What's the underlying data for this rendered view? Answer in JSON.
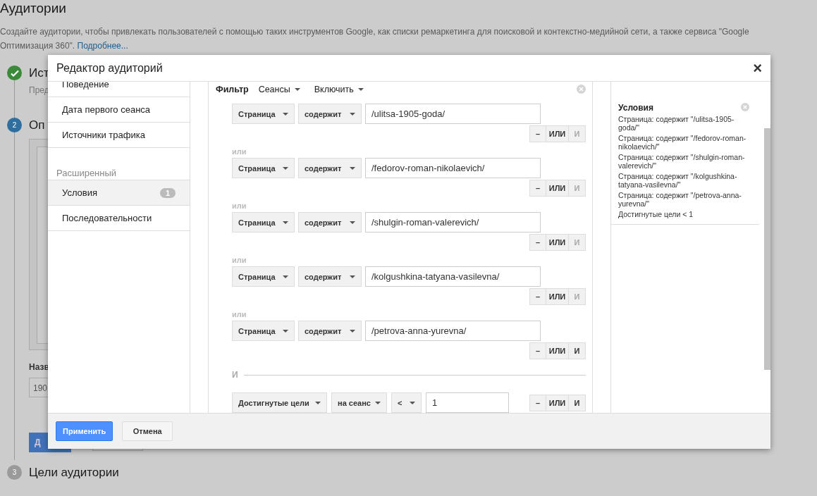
{
  "page": {
    "title": "Аудитории",
    "description": "Создайте аудитории, чтобы привлекать пользователей с помощью таких инструментов Google, как списки ремаркетинга для поисковой и контекстно-медийной сети, а также сервиса \"Google Оптимизация 360\".",
    "link": "Подробнее..."
  },
  "steps": [
    {
      "kind": "done",
      "title": "Ист",
      "subtitle": "Пред"
    },
    {
      "kind": "current",
      "number": "2",
      "title": "Оп",
      "field_label": "Назв",
      "field_value": "190",
      "button": "Д"
    },
    {
      "kind": "pending",
      "number": "3",
      "title": "Цели аудитории"
    }
  ],
  "modal": {
    "title": "Редактор аудиторий",
    "close": "×",
    "nav": [
      {
        "kind": "item",
        "label": "Поведение",
        "selected": false
      },
      {
        "kind": "item",
        "label": "Дата первого сеанса",
        "selected": false
      },
      {
        "kind": "item",
        "label": "Источники трафика",
        "selected": false
      },
      {
        "kind": "header",
        "label": "Расширенный"
      },
      {
        "kind": "item",
        "label": "Условия",
        "badge": "1",
        "selected": true
      },
      {
        "kind": "item",
        "label": "Последовательности",
        "selected": false
      }
    ],
    "filter": {
      "label": "Фильтр",
      "scope": "Сеансы",
      "mode": "Включить",
      "conditions": [
        {
          "field": "Страница",
          "operator": "содержит",
          "value": "/ulitsa-1905-goda/",
          "remove": "–",
          "or": "ИЛИ",
          "and": "И",
          "and_disabled": true
        },
        {
          "joiner": "или",
          "field": "Страница",
          "operator": "содержит",
          "value": "/fedorov-roman-nikolaevich/",
          "remove": "–",
          "or": "ИЛИ",
          "and": "И",
          "and_disabled": true
        },
        {
          "joiner": "или",
          "field": "Страница",
          "operator": "содержит",
          "value": "/shulgin-roman-valerevich/",
          "remove": "–",
          "or": "ИЛИ",
          "and": "И",
          "and_disabled": true
        },
        {
          "joiner": "или",
          "field": "Страница",
          "operator": "содержит",
          "value": "/kolgushkina-tatyana-vasilevna/",
          "remove": "–",
          "or": "ИЛИ",
          "and": "И",
          "and_disabled": true
        },
        {
          "joiner": "или",
          "field": "Страница",
          "operator": "содержит",
          "value": "/petrova-anna-yurevna/",
          "remove": "–",
          "or": "ИЛИ",
          "and": "И",
          "and_disabled": false
        }
      ],
      "and_label": "И",
      "goal": {
        "field": "Достигнутые цели",
        "per": "на сеанс",
        "operator": "<",
        "value": "1",
        "remove": "–",
        "or": "ИЛИ",
        "and": "И",
        "and_disabled": false
      }
    },
    "summary": {
      "title": "Условия",
      "lines": [
        "Страница: содержит \"/ulitsa-1905-goda/\"",
        "Страница: содержит \"/fedorov-roman-nikolaevich/\"",
        "Страница: содержит \"/shulgin-roman-valerevich/\"",
        "Страница: содержит \"/kolgushkina-tatyana-vasilevna/\"",
        "Страница: содержит \"/petrova-anna-yurevna/\"",
        "Достигнутые цели < 1"
      ]
    },
    "apply": "Применить",
    "cancel": "Отмена"
  }
}
